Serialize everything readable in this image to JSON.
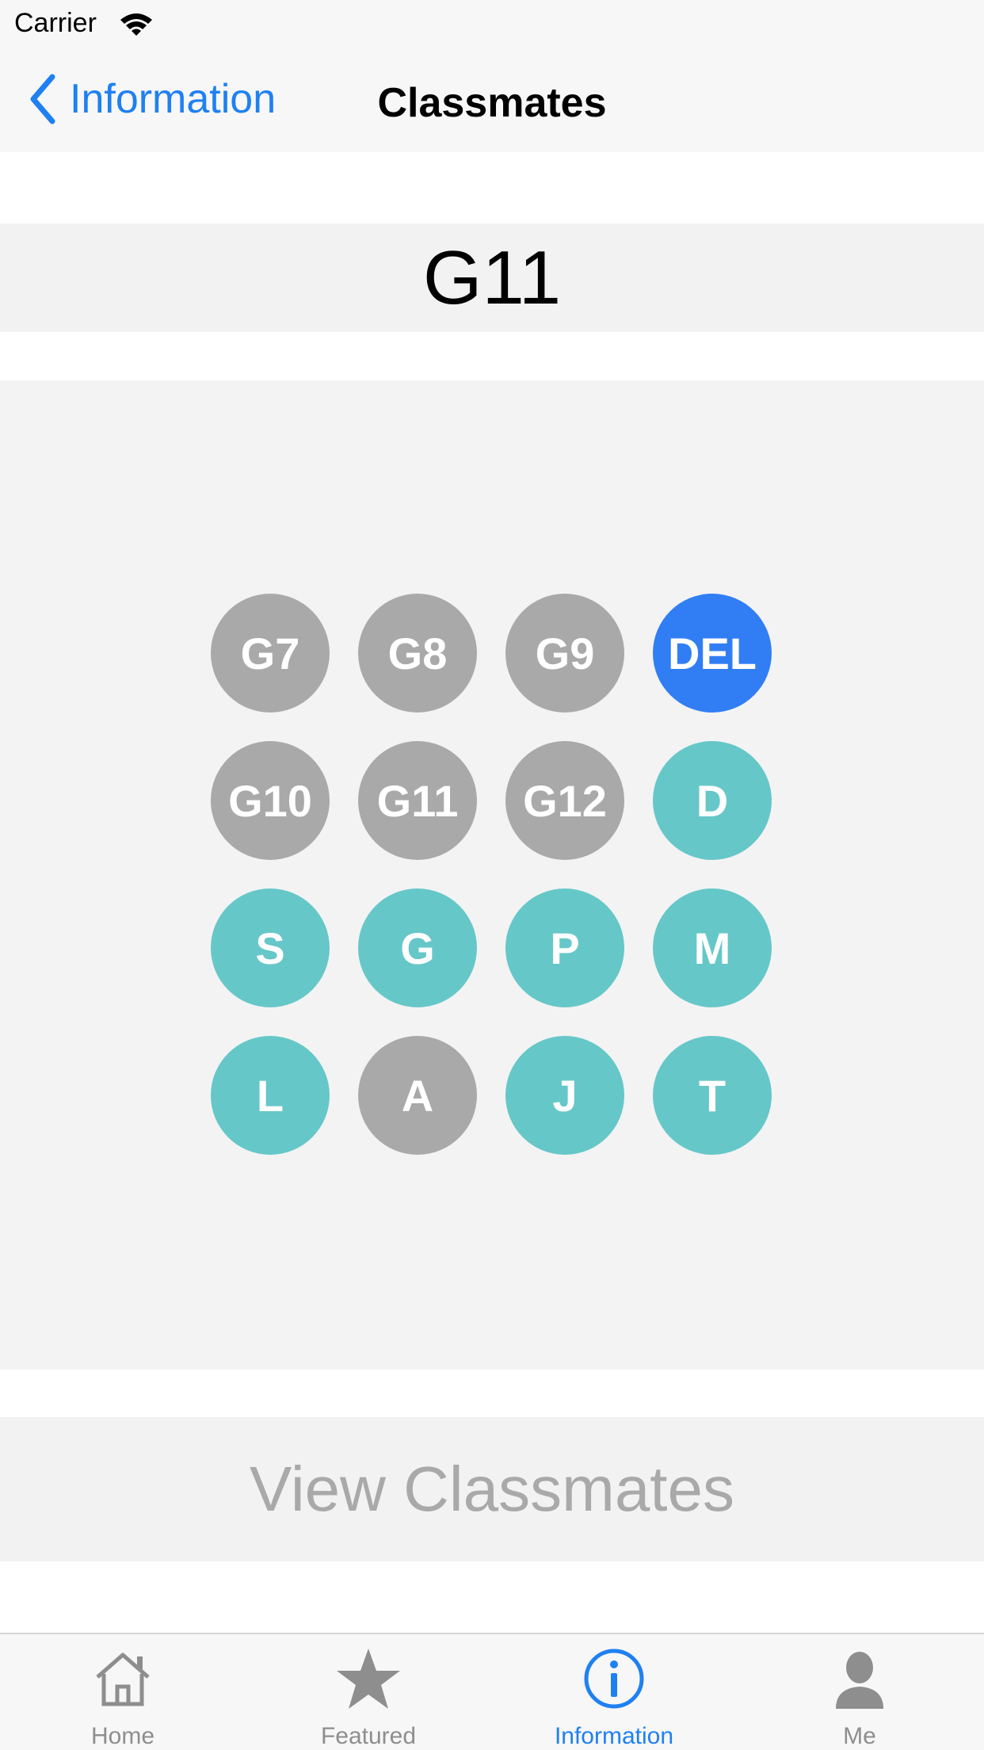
{
  "status_bar": {
    "carrier": "Carrier",
    "wifi_icon": "wifi-icon"
  },
  "nav": {
    "back_label": "Information",
    "back_icon": "chevron-left-icon",
    "title": "Classmates"
  },
  "display": {
    "value": "G11"
  },
  "keypad": {
    "keys": [
      {
        "label": "G7",
        "color": "grey"
      },
      {
        "label": "G8",
        "color": "grey"
      },
      {
        "label": "G9",
        "color": "grey"
      },
      {
        "label": "DEL",
        "color": "blue"
      },
      {
        "label": "G10",
        "color": "grey"
      },
      {
        "label": "G11",
        "color": "grey"
      },
      {
        "label": "G12",
        "color": "grey"
      },
      {
        "label": "D",
        "color": "teal"
      },
      {
        "label": "S",
        "color": "teal"
      },
      {
        "label": "G",
        "color": "teal"
      },
      {
        "label": "P",
        "color": "teal"
      },
      {
        "label": "M",
        "color": "teal"
      },
      {
        "label": "L",
        "color": "teal"
      },
      {
        "label": "A",
        "color": "grey"
      },
      {
        "label": "J",
        "color": "teal"
      },
      {
        "label": "T",
        "color": "teal"
      }
    ]
  },
  "view_button": {
    "label": "View Classmates"
  },
  "tab_bar": {
    "tabs": [
      {
        "label": "Home",
        "icon": "home-icon",
        "active": false
      },
      {
        "label": "Featured",
        "icon": "star-icon",
        "active": false
      },
      {
        "label": "Information",
        "icon": "info-icon",
        "active": true
      },
      {
        "label": "Me",
        "icon": "person-icon",
        "active": false
      }
    ]
  },
  "colors": {
    "accent_blue": "#1f80f2",
    "key_grey": "#a9a9a9",
    "key_teal": "#66c7c8",
    "key_blue": "#317ef4",
    "inactive_tab": "#8e8e8e"
  }
}
